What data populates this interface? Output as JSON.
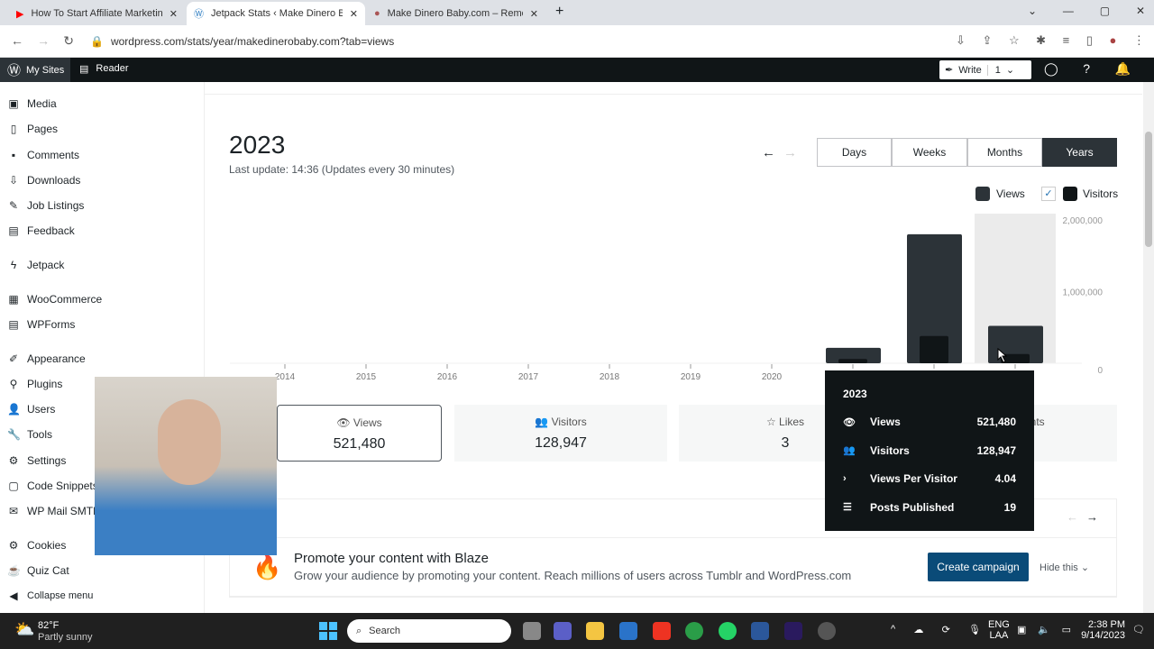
{
  "browser": {
    "tabs": [
      {
        "title": "How To Start Affiliate Marketing",
        "icon": "youtube-icon",
        "active": false
      },
      {
        "title": "Jetpack Stats ‹ Make Dinero Baby",
        "icon": "wordpress-icon",
        "active": true
      },
      {
        "title": "Make Dinero Baby.com – Remote",
        "icon": "site-avatar-icon",
        "active": false
      }
    ],
    "url": "wordpress.com/stats/year/makedinerobaby.com?tab=views"
  },
  "wpbar": {
    "my_sites": "My Sites",
    "reader": "Reader",
    "write": "Write",
    "write_count": "1"
  },
  "sidebar": {
    "items": [
      "Media",
      "Pages",
      "Comments",
      "Downloads",
      "Job Listings",
      "Feedback",
      "Jetpack",
      "WooCommerce",
      "WPForms",
      "Appearance",
      "Plugins",
      "Users",
      "Tools",
      "Settings",
      "Code Snippets",
      "WP Mail SMTP",
      "Cookies",
      "Quiz Cat",
      "Collapse menu"
    ]
  },
  "stats": {
    "title": "2023",
    "last_update": "Last update: 14:36 (Updates every 30 minutes)",
    "periods": [
      "Days",
      "Weeks",
      "Months",
      "Years"
    ],
    "selected_period": "Years",
    "legend": {
      "views": "Views",
      "visitors": "Visitors",
      "visitors_checked": true
    },
    "cards": [
      {
        "label": "Views",
        "value": "521,480"
      },
      {
        "label": "Visitors",
        "value": "128,947"
      },
      {
        "label": "Likes",
        "value": "3"
      },
      {
        "label": "Comments",
        "value": "nts"
      }
    ]
  },
  "chart_data": {
    "type": "bar",
    "categories": [
      "2014",
      "2015",
      "2016",
      "2017",
      "2018",
      "2019",
      "2020",
      "2021",
      "2022",
      "2023"
    ],
    "series": [
      {
        "name": "Views",
        "values": [
          0,
          0,
          0,
          0,
          0,
          0,
          0,
          215000,
          1800000,
          521480
        ],
        "color": "#2c3338"
      },
      {
        "name": "Visitors",
        "values": [
          0,
          0,
          0,
          0,
          0,
          0,
          0,
          60000,
          380000,
          128947
        ],
        "color": "#101517"
      }
    ],
    "yticks": [
      "0",
      "1,000,000",
      "2,000,000"
    ],
    "ylim": [
      0,
      2000000
    ],
    "highlighted": "2023"
  },
  "tooltip": {
    "title": "2023",
    "rows": [
      {
        "icon": "eye-icon",
        "label": "Views",
        "value": "521,480"
      },
      {
        "icon": "people-icon",
        "label": "Visitors",
        "value": "128,947"
      },
      {
        "icon": "chevron-right-icon",
        "label": "Views Per Visitor",
        "value": "4.04"
      },
      {
        "icon": "list-icon",
        "label": "Posts Published",
        "value": "19"
      }
    ]
  },
  "blaze": {
    "title": "Promote your content with Blaze",
    "text": "Grow your audience by promoting your content. Reach millions of users across Tumblr and WordPress.com",
    "button": "Create campaign",
    "hide": "Hide this"
  },
  "taskbar": {
    "temp": "82°F",
    "weather": "Partly sunny",
    "search": "Search",
    "lang1": "ENG",
    "lang2": "LAA",
    "time": "2:38 PM",
    "date": "9/14/2023"
  }
}
